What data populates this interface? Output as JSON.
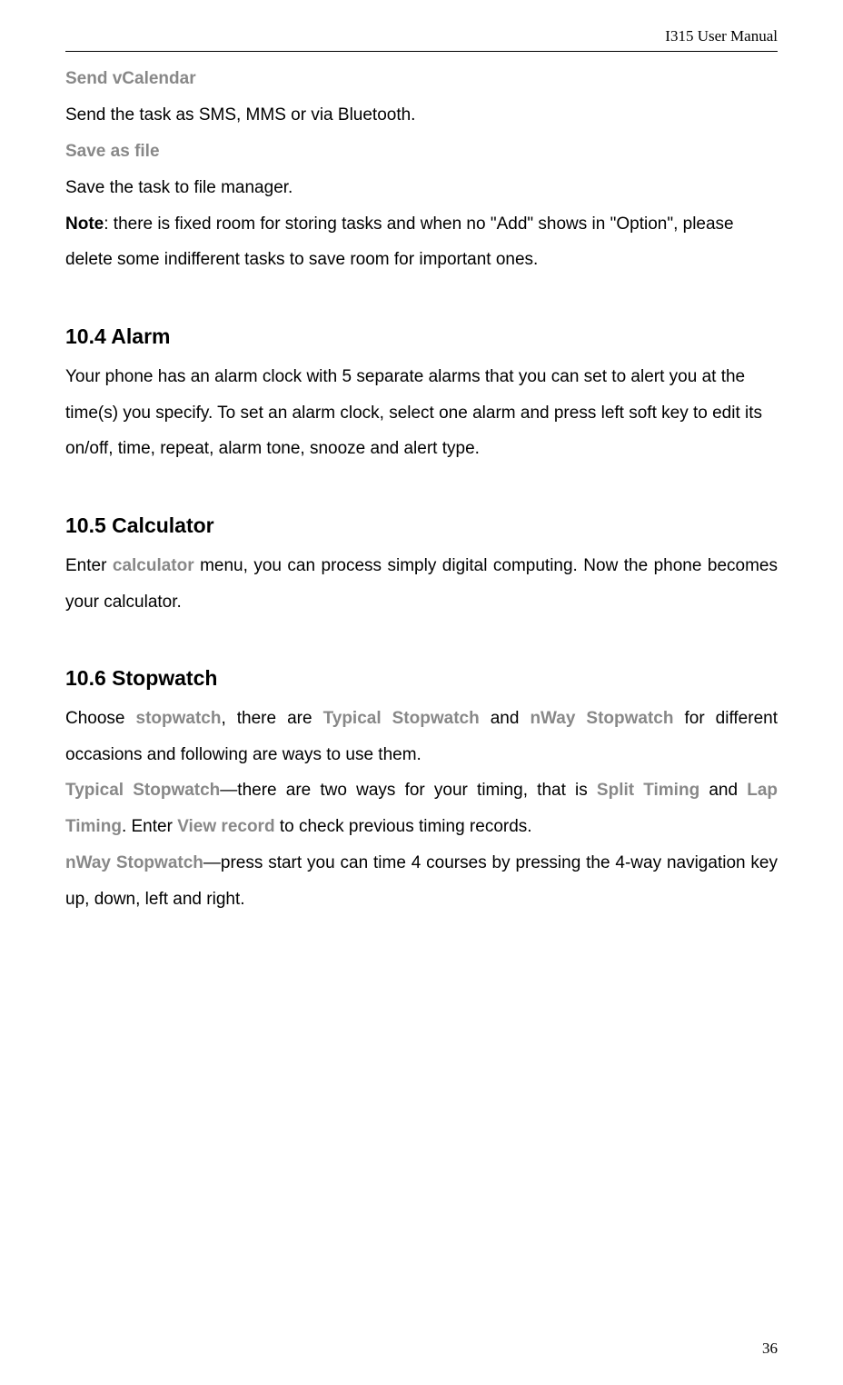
{
  "header": {
    "title": "I315 User Manual"
  },
  "send_vcalendar": {
    "title": "Send vCalendar",
    "body": "Send the task as SMS, MMS or via Bluetooth."
  },
  "save_as_file": {
    "title": "Save as file",
    "body": "Save the task to file manager.",
    "note_label": "Note",
    "note_body": ": there is fixed room for storing tasks and when no \"Add\" shows in \"Option\", please delete some indifferent tasks to save room for important ones."
  },
  "alarm": {
    "heading": "10.4 Alarm",
    "body": "Your phone has an alarm clock with 5 separate alarms that you can set to alert you at the time(s) you specify. To set an alarm clock, select one alarm and press left soft key to edit its on/off, time, repeat, alarm tone, snooze and alert type."
  },
  "calculator": {
    "heading": "10.5 Calculator",
    "body_prefix": "Enter ",
    "body_keyword": "calculator",
    "body_suffix": " menu, you can process simply digital computing. Now the phone becomes your calculator."
  },
  "stopwatch": {
    "heading": "10.6 Stopwatch",
    "intro_prefix": "Choose ",
    "intro_kw1": "stopwatch",
    "intro_mid1": ", there are ",
    "intro_kw2": "Typical Stopwatch",
    "intro_mid2": " and ",
    "intro_kw3": "nWay Stopwatch",
    "intro_suffix": " for different occasions and following are ways to use them.",
    "typical_label": "Typical Stopwatch",
    "typical_mid1": "—there are two ways for your timing, that is ",
    "typical_kw1": "Split Timing",
    "typical_mid2": " and ",
    "typical_kw2": "Lap Timing",
    "typical_suffix": ". Enter ",
    "typical_kw3": "View record",
    "typical_end": " to check previous timing records.",
    "nway_label": "nWay Stopwatch",
    "nway_body": "—press start you can time 4 courses by pressing the 4-way navigation key up, down, left and right."
  },
  "footer": {
    "page_number": "36"
  }
}
